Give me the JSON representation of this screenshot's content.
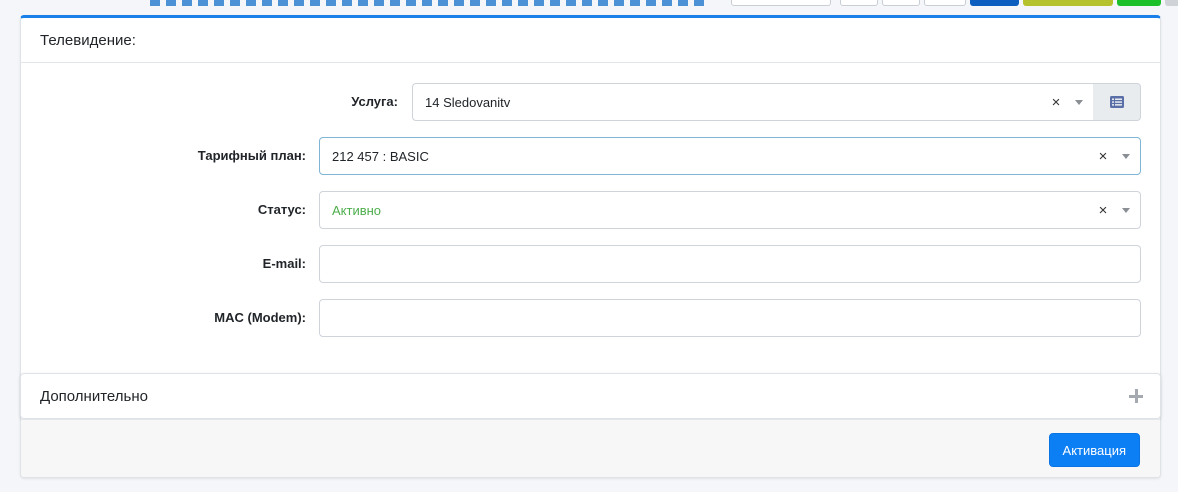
{
  "card": {
    "title": "Телевидение:"
  },
  "form": {
    "service": {
      "label": "Услуга:",
      "value": "14 Sledovanitv",
      "clear": "×"
    },
    "tariff": {
      "label": "Тарифный план:",
      "value": "212 457 : BASIC",
      "clear": "×"
    },
    "status": {
      "label": "Статус:",
      "value": "Активно",
      "clear": "×",
      "value_color": "#4cae4c"
    },
    "email": {
      "label": "E-mail:",
      "value": ""
    },
    "mac": {
      "label": "MAC (Modem):",
      "value": ""
    }
  },
  "additional": {
    "label": "Дополнительно",
    "icon": "plus-icon"
  },
  "footer": {
    "activate_label": "Активация"
  },
  "colors": {
    "accent": "#1a7fe8",
    "primary_button": "#0d7ff5",
    "status_active": "#4cae4c"
  }
}
